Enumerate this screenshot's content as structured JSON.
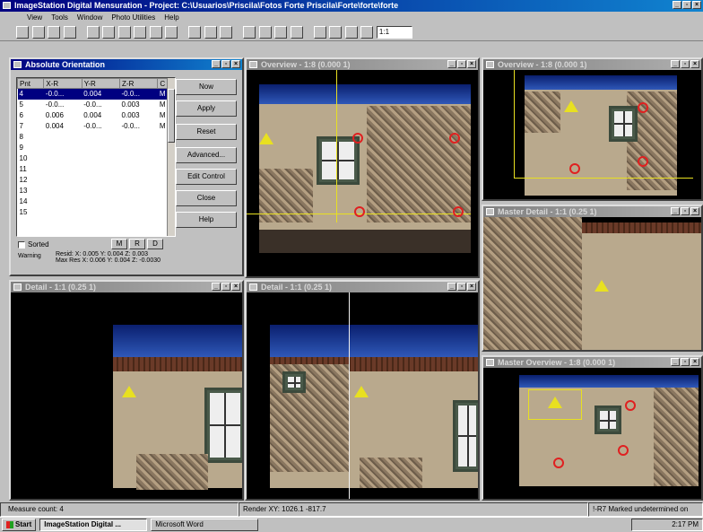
{
  "app": {
    "title": "ImageStation Digital Mensuration - Project: C:\\Usuarios\\Priscila\\Fotos Forte Priscila\\Forte\\forte\\forte",
    "menu": [
      "View",
      "Tools",
      "Window",
      "Photo Utilities",
      "Help"
    ],
    "zoom_value": "1:1",
    "zoom_label": "1 to 1"
  },
  "orientation_dialog": {
    "title": "Absolute Orientation",
    "columns": [
      "Pnt",
      "X-R",
      "Y-R",
      "Z-R",
      "C"
    ],
    "rows": [
      {
        "pnt": "4",
        "x": "-0.0...",
        "y": "0.004",
        "z": "-0.0...",
        "c": "M"
      },
      {
        "pnt": "5",
        "x": "-0.0...",
        "y": "-0.0...",
        "z": "0.003",
        "c": "M"
      },
      {
        "pnt": "6",
        "x": "0.006",
        "y": "0.004",
        "z": "0.003",
        "c": "M"
      },
      {
        "pnt": "7",
        "x": "0.004",
        "y": "-0.0...",
        "z": "-0.0...",
        "c": "M"
      },
      {
        "pnt": "8",
        "x": "",
        "y": "",
        "z": "",
        "c": ""
      },
      {
        "pnt": "9",
        "x": "",
        "y": "",
        "z": "",
        "c": ""
      },
      {
        "pnt": "10",
        "x": "",
        "y": "",
        "z": "",
        "c": ""
      },
      {
        "pnt": "11",
        "x": "",
        "y": "",
        "z": "",
        "c": ""
      },
      {
        "pnt": "12",
        "x": "",
        "y": "",
        "z": "",
        "c": ""
      },
      {
        "pnt": "13",
        "x": "",
        "y": "",
        "z": "",
        "c": ""
      },
      {
        "pnt": "14",
        "x": "",
        "y": "",
        "z": "",
        "c": ""
      },
      {
        "pnt": "15",
        "x": "",
        "y": "",
        "z": "",
        "c": ""
      }
    ],
    "buttons": [
      "Now",
      "Apply",
      "Reset",
      "Advanced...",
      "Edit Control",
      "Close",
      "Help"
    ],
    "sorted_label": "Sorted",
    "mode_buttons": [
      "M",
      "R",
      "D"
    ],
    "warning_label": "Warning",
    "resid_label": "Resid:",
    "resid_values": "X: 0.005  Y: 0.004  Z: 0.003",
    "max_res_label": "Max Res X: 0.006  Y: 0.004  Z: -0.0030"
  },
  "views": {
    "top_center": "Overview - 1:8 (0.000 1)",
    "top_right": "Overview - 1:8 (0.000 1)",
    "mid_right": "Master Detail - 1:1 (0.25 1)",
    "bottom_left": "Detail - 1:1 (0.25 1)",
    "bottom_center": "Detail - 1:1 (0.25 1)",
    "bottom_right": "Master Overview - 1:8 (0.000 1)"
  },
  "status": {
    "left": "Measure count: 4",
    "center": "Render XY: 1026.1 -817.7",
    "right": "!-R7 Marked undetermined on"
  },
  "taskbar": {
    "start": "Start",
    "tasks": [
      "ImageStation Digital ...",
      "Microsoft Word"
    ],
    "clock": "2:17 PM"
  }
}
